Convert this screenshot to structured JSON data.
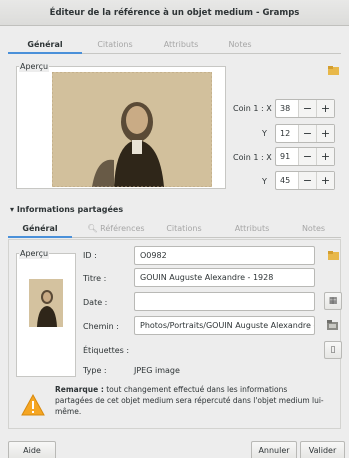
{
  "window": {
    "title": "Éditeur de la référence à un objet medium - Gramps"
  },
  "top_tabs": [
    "Général",
    "Citations",
    "Attributs",
    "Notes"
  ],
  "preview": {
    "legend": "Aperçu",
    "corner1_x_label": "Coin 1 : X",
    "corner1_y_label": "Y",
    "corner2_x_label": "Coin 1 : X",
    "corner2_y_label": "Y",
    "corner1_x": "38",
    "corner1_y": "12",
    "corner2_x": "91",
    "corner2_y": "45",
    "minus": "−",
    "plus": "+"
  },
  "shared": {
    "expander": "Informations partagées"
  },
  "shared_tabs": [
    "Général",
    "Références",
    "Citations",
    "Attributs",
    "Notes"
  ],
  "media": {
    "legend": "Aperçu",
    "id_label": "ID :",
    "id_value": "O0982",
    "title_label": "Titre :",
    "title_value": "GOUIN Auguste Alexandre - 1928",
    "date_label": "Date :",
    "date_value": "",
    "path_label": "Chemin :",
    "path_value": "Photos/Portraits/GOUIN Auguste Alexandre -",
    "tags_label": "Étiquettes :",
    "tags_value": "",
    "type_label": "Type :",
    "type_value": "JPEG image"
  },
  "note": {
    "bold": "Remarque :",
    "text": " tout changement effectué dans les informations partagées de cet objet medium sera répercuté dans l'objet medium lui-même."
  },
  "buttons": {
    "help": "Aide",
    "cancel": "Annuler",
    "ok": "Valider"
  },
  "colors": {
    "accent": "#4a90d9",
    "warning": "#f5a623"
  }
}
